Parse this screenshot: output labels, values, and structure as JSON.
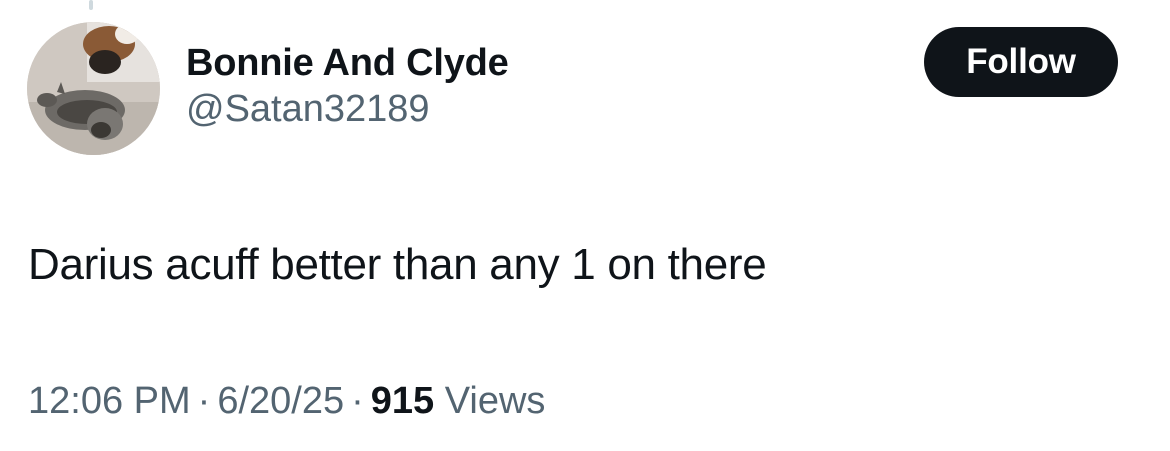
{
  "user": {
    "display_name": "Bonnie And Clyde",
    "handle": "@Satan32189",
    "avatar_icon": "cat-photo-avatar"
  },
  "follow_label": "Follow",
  "tweet": {
    "text": "Darius acuff better than any 1 on there",
    "time": "12:06 PM",
    "date": "6/20/25",
    "separator": "·",
    "views_count": "915",
    "views_label": "Views"
  },
  "colors": {
    "primary_text": "#0f1419",
    "secondary_text": "#536471",
    "button_bg": "#0f1419",
    "button_text": "#ffffff"
  }
}
